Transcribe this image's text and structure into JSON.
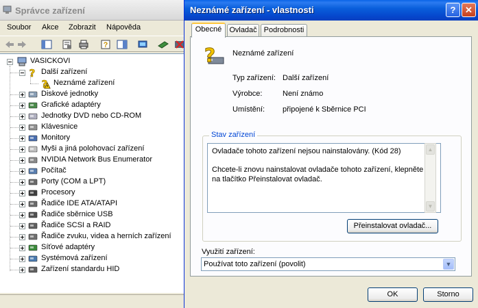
{
  "devmgr": {
    "title": "Správce zařízení",
    "menu": [
      "Soubor",
      "Akce",
      "Zobrazit",
      "Nápověda"
    ],
    "toolbar_icons": [
      "back-icon",
      "forward-icon",
      "tree-view-icon",
      "properties-icon",
      "print-icon",
      "help-icon",
      "console-icon",
      "scan-hardware-icon",
      "update-driver-icon",
      "uninstall-icon"
    ],
    "tree": {
      "root": "VASICKOVI",
      "items": [
        {
          "label": "Další zařízení",
          "expanded": true,
          "icon": "question-device-icon"
        },
        {
          "label": "Neznámé zařízení",
          "child": true,
          "icon": "unknown-device-warning-icon"
        },
        {
          "label": "Diskové jednotky",
          "icon": "disk-icon"
        },
        {
          "label": "Grafické adaptéry",
          "icon": "display-adapter-icon"
        },
        {
          "label": "Jednotky DVD nebo CD-ROM",
          "icon": "cdrom-icon"
        },
        {
          "label": "Klávesnice",
          "icon": "keyboard-icon"
        },
        {
          "label": "Monitory",
          "icon": "monitor-icon"
        },
        {
          "label": "Myši a jiná polohovací zařízení",
          "icon": "mouse-icon"
        },
        {
          "label": "NVIDIA Network Bus Enumerator",
          "icon": "network-bus-icon"
        },
        {
          "label": "Počítač",
          "icon": "computer-icon"
        },
        {
          "label": "Porty (COM a LPT)",
          "icon": "port-icon"
        },
        {
          "label": "Procesory",
          "icon": "processor-icon"
        },
        {
          "label": "Řadiče IDE ATA/ATAPI",
          "icon": "ide-controller-icon"
        },
        {
          "label": "Řadiče sběrnice USB",
          "icon": "usb-icon"
        },
        {
          "label": "Řadiče SCSI a RAID",
          "icon": "scsi-icon"
        },
        {
          "label": "Řadiče zvuku, videa a herních zařízení",
          "icon": "sound-icon"
        },
        {
          "label": "Síťové adaptéry",
          "icon": "network-adapter-icon"
        },
        {
          "label": "Systémová zařízení",
          "icon": "system-device-icon"
        },
        {
          "label": "Zařízení standardu HID",
          "icon": "hid-icon"
        }
      ]
    }
  },
  "dialog": {
    "title": "Neznámé zařízení - vlastnosti",
    "help_button": "?",
    "close_button": "✕",
    "tabs": [
      "Obecné",
      "Ovladač",
      "Podrobnosti"
    ],
    "device_name": "Neznámé zařízení",
    "properties": [
      {
        "label": "Typ zařízení:",
        "value": "Další zařízení"
      },
      {
        "label": "Výrobce:",
        "value": "Není známo"
      },
      {
        "label": "Umístění:",
        "value": "připojené k Sběrnice PCI"
      }
    ],
    "status_group": "Stav zařízení",
    "status_lines": [
      "Ovladače tohoto zařízení nejsou nainstalovány. (Kód 28)",
      "Chcete-li znovu nainstalovat ovladače tohoto zařízení, klepněte",
      "na tlačítko Přeinstalovat ovladač."
    ],
    "reinstall_button": "Přeinstalovat ovladač...",
    "usage_label": "Využití zařízení:",
    "usage_value": "Používat toto zařízení (povolit)",
    "ok_button": "OK",
    "cancel_button": "Storno"
  },
  "colors": {
    "title_active": "#0a5fdc",
    "group_legend": "#0046d5",
    "tab_highlight": "#ffc73c"
  }
}
